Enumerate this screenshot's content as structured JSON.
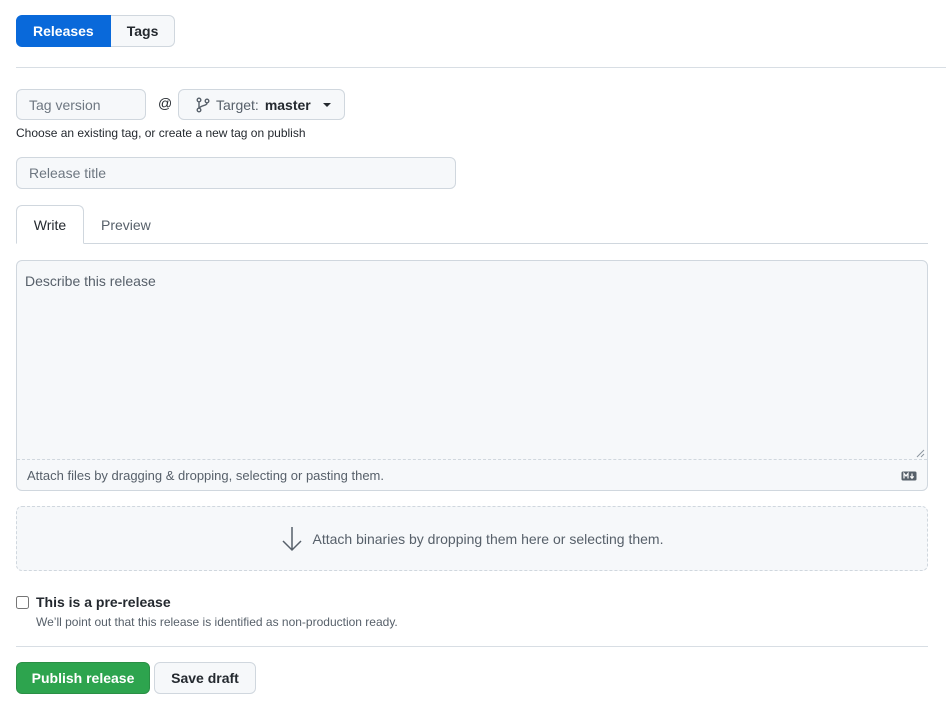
{
  "nav": {
    "releases_label": "Releases",
    "tags_label": "Tags"
  },
  "tag": {
    "placeholder": "Tag version",
    "at_symbol": "@",
    "target_label": "Target:",
    "target_value": "master",
    "hint": "Choose an existing tag, or create a new tag on publish"
  },
  "title": {
    "placeholder": "Release title"
  },
  "editor": {
    "tabs": [
      "Write",
      "Preview"
    ],
    "placeholder": "Describe this release",
    "attach_text": "Attach files by dragging & dropping, selecting or pasting them."
  },
  "binaries": {
    "text": "Attach binaries by dropping them here or selecting them."
  },
  "prerelease": {
    "label": "This is a pre-release",
    "note": "We’ll point out that this release is identified as non-production ready.",
    "checked": false
  },
  "actions": {
    "publish_label": "Publish release",
    "draft_label": "Save draft"
  },
  "colors": {
    "primary_blue": "#0969da",
    "publish_green": "#2da44e",
    "border": "#d0d7de",
    "input_bg": "#f6f8fa"
  }
}
